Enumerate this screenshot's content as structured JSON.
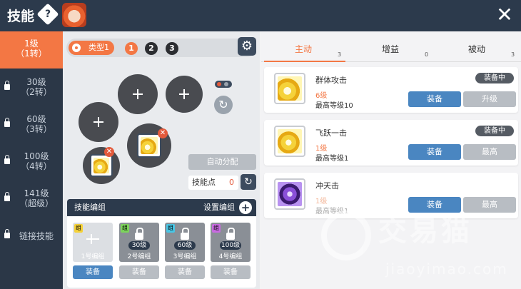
{
  "header": {
    "title": "技能",
    "help": "?",
    "close": "✕"
  },
  "sidebar": {
    "items": [
      {
        "line1": "1级",
        "line2": "（1转）",
        "active": true,
        "locked": false
      },
      {
        "line1": "30级",
        "line2": "（2转）",
        "active": false,
        "locked": true
      },
      {
        "line1": "60级",
        "line2": "（3转）",
        "active": false,
        "locked": true
      },
      {
        "line1": "100级",
        "line2": "（4转）",
        "active": false,
        "locked": true
      },
      {
        "line1": "141级",
        "line2": "（超级）",
        "active": false,
        "locked": true
      },
      {
        "line1": "链接技能",
        "line2": "",
        "active": false,
        "locked": true
      }
    ]
  },
  "typebar": {
    "type_label": "类型1",
    "numbers": [
      "1",
      "2",
      "3"
    ]
  },
  "auto_assign": "自动分配",
  "skill_points": {
    "label": "技能点",
    "value": "0"
  },
  "skill_group": {
    "title": "技能编组",
    "setting": "设置编组",
    "add": "+",
    "cards": [
      {
        "tag": "组",
        "level": "",
        "name": "1号编组",
        "button": "装备",
        "locked": false
      },
      {
        "tag": "组",
        "level": "30级",
        "name": "2号编组",
        "button": "装备",
        "locked": true
      },
      {
        "tag": "组",
        "level": "60级",
        "name": "3号编组",
        "button": "装备",
        "locked": true
      },
      {
        "tag": "组",
        "level": "100级",
        "name": "4号编组",
        "button": "装备",
        "locked": true
      }
    ]
  },
  "tabs": [
    {
      "label": "主动",
      "count": "3",
      "active": true
    },
    {
      "label": "增益",
      "count": "0",
      "active": false
    },
    {
      "label": "被动",
      "count": "3",
      "active": false
    }
  ],
  "skills": [
    {
      "name": "群体攻击",
      "level": "6级",
      "max": "最高等级10",
      "equipped": "装备中",
      "btn1": "装备",
      "btn2": "升级"
    },
    {
      "name": "飞跃一击",
      "level": "1级",
      "max": "最高等级1",
      "equipped": "装备中",
      "btn1": "装备",
      "btn2": "最高"
    },
    {
      "name": "冲天击",
      "level": "1级",
      "max": "最高等级1",
      "equipped": "",
      "btn1": "装备",
      "btn2": "最高"
    }
  ],
  "watermark": {
    "text": "交易猫",
    "url": "jiaoyimao.com"
  },
  "colors": {
    "accent": "#f37744",
    "blue_button": "#4a86c1",
    "dark": "#2c3a4c"
  }
}
